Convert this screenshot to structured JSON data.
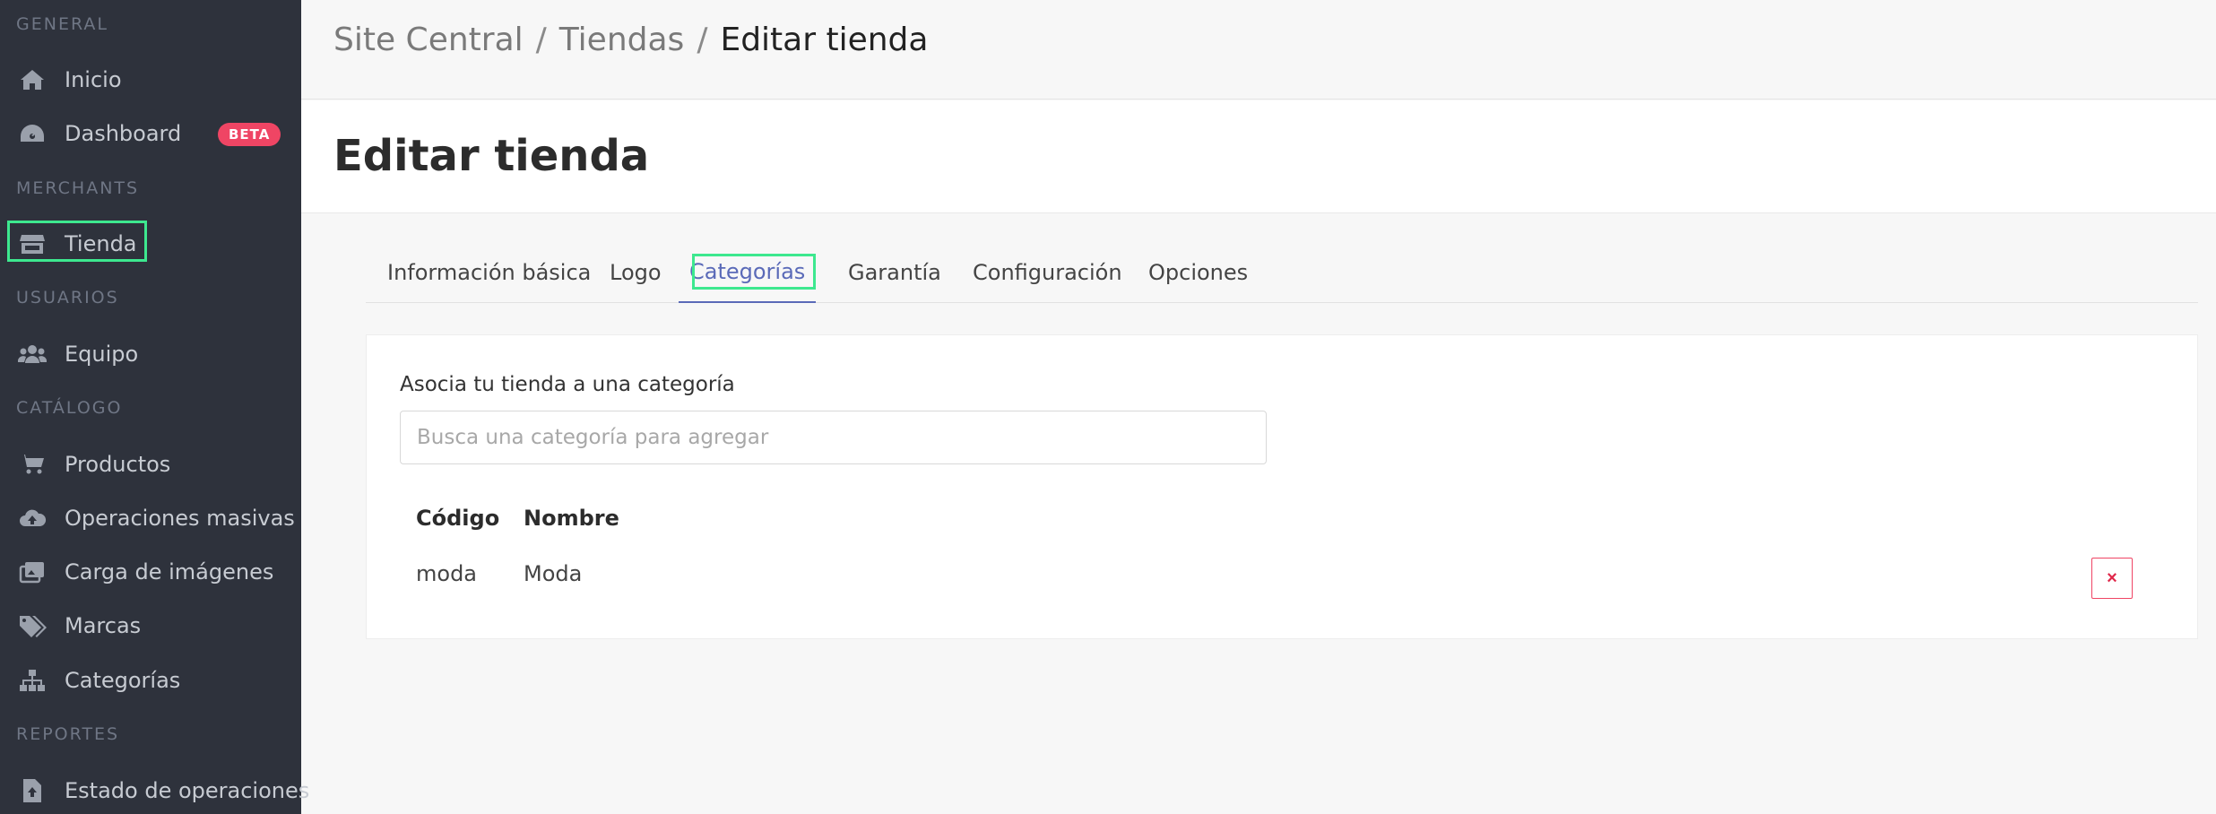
{
  "sidebar": {
    "sections": {
      "general": "GENERAL",
      "merchants": "MERCHANTS",
      "usuarios": "USUARIOS",
      "catalogo": "CATÁLOGO",
      "reportes": "REPORTES"
    },
    "items": {
      "inicio": {
        "label": "Inicio",
        "icon": "home-icon"
      },
      "dashboard": {
        "label": "Dashboard",
        "icon": "dashboard-gauge-icon",
        "badge": "BETA"
      },
      "tienda": {
        "label": "Tienda",
        "icon": "store-icon",
        "active": true
      },
      "equipo": {
        "label": "Equipo",
        "icon": "users-icon"
      },
      "productos": {
        "label": "Productos",
        "icon": "cart-icon"
      },
      "operaciones": {
        "label": "Operaciones masivas",
        "icon": "cloud-upload-icon"
      },
      "carga": {
        "label": "Carga de imágenes",
        "icon": "images-icon"
      },
      "marcas": {
        "label": "Marcas",
        "icon": "tags-icon"
      },
      "categorias": {
        "label": "Categorías",
        "icon": "sitemap-icon"
      },
      "estado": {
        "label": "Estado de operaciones",
        "icon": "file-upload-icon"
      }
    }
  },
  "breadcrumb": {
    "items": [
      "Site Central",
      "Tiendas"
    ],
    "current": "Editar tienda",
    "separator": "/"
  },
  "page": {
    "title": "Editar tienda"
  },
  "tabs": {
    "info": "Información básica",
    "logo": "Logo",
    "categorias": "Categorías",
    "garantia": "Garantía",
    "configuracion": "Configuración",
    "opciones": "Opciones",
    "active": "Categorías"
  },
  "category_card": {
    "title": "Asocia tu tienda a una categoría",
    "search_placeholder": "Busca una categoría para agregar",
    "columns": [
      "Código",
      "Nombre"
    ],
    "rows": [
      {
        "codigo": "moda",
        "nombre": "Moda"
      }
    ],
    "delete_label": "×"
  },
  "colors": {
    "sidebar_bg": "#2e323c",
    "accent": "#5a6ab8",
    "danger": "#ef4564",
    "highlight": "#3de88f"
  }
}
